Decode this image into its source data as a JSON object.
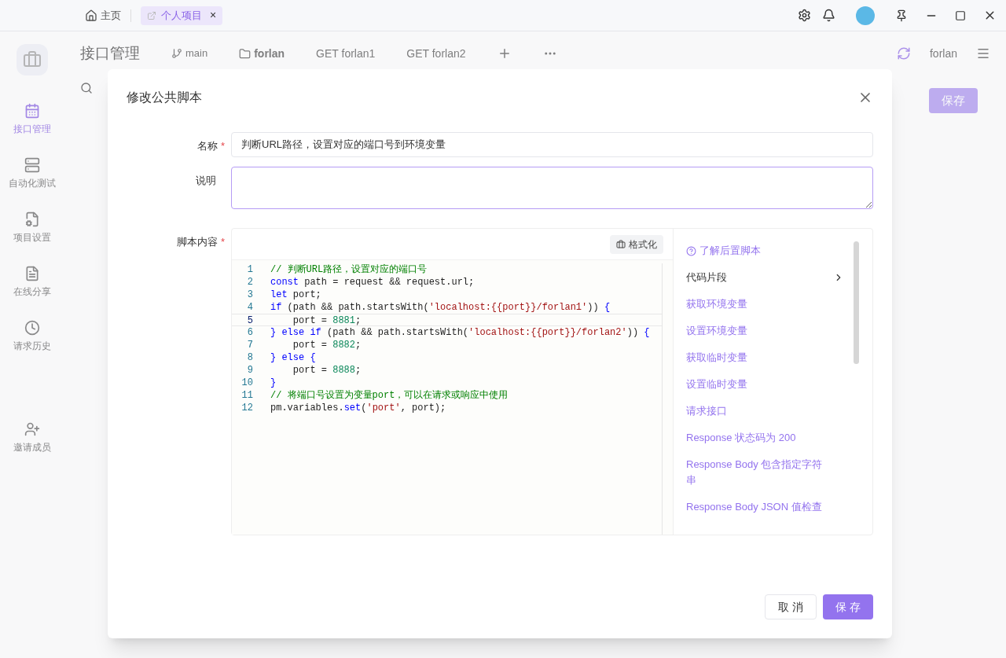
{
  "titlebar": {
    "home": {
      "label": "主页"
    },
    "tabs": [
      {
        "label": "个人项目",
        "selected": true,
        "close": "×"
      }
    ]
  },
  "app": {
    "title": "接口管理",
    "branch": "main",
    "tabs": [
      {
        "kind": "folder",
        "label": "forlan"
      },
      {
        "kind": "request",
        "label": "GET forlan1"
      },
      {
        "kind": "request",
        "label": "GET forlan2"
      }
    ],
    "user": "forlan",
    "save": "保存",
    "nav": [
      {
        "label": "接口管理",
        "selected": true
      },
      {
        "label": "自动化测试",
        "selected": false
      },
      {
        "label": "项目设置",
        "selected": false
      },
      {
        "label": "在线分享",
        "selected": false
      },
      {
        "label": "请求历史",
        "selected": false
      },
      {
        "label": "邀请成员",
        "selected": false
      }
    ]
  },
  "dialog": {
    "title": "修改公共脚本",
    "fields": [
      {
        "label": "名称",
        "required_mark": "*",
        "value": "判断URL路径，设置对应的端口号到环境变量"
      },
      {
        "label": "说明",
        "placeholder_focused": true
      }
    ],
    "script": {
      "label": "脚本内容",
      "required_mark": "*",
      "format_button": "格式化",
      "lines": [
        {
          "number": "1",
          "selected": false,
          "tokens": [
            {
              "kind": "comment",
              "text": "// 判断URL路径，设置对应的端口号"
            }
          ]
        },
        {
          "number": "2",
          "selected": false,
          "tokens": [
            {
              "kind": "keyword",
              "text": "const"
            },
            {
              "kind": "plain",
              "text": " path = request && request.url;"
            }
          ]
        },
        {
          "number": "3",
          "selected": false,
          "tokens": [
            {
              "kind": "keyword",
              "text": "let"
            },
            {
              "kind": "plain",
              "text": " port;"
            }
          ]
        },
        {
          "number": "4",
          "selected": false,
          "tokens": [
            {
              "kind": "keyword",
              "text": "if"
            },
            {
              "kind": "plain",
              "text": " (path && path.startsWith("
            },
            {
              "kind": "string",
              "text": "'localhost:{{port}}/forlan1'"
            },
            {
              "kind": "plain",
              "text": ")) "
            },
            {
              "kind": "keyword",
              "text": "{"
            }
          ]
        },
        {
          "number": "5",
          "selected": true,
          "tokens": [
            {
              "kind": "plain",
              "text": "    port = "
            },
            {
              "kind": "number",
              "text": "8881"
            },
            {
              "kind": "plain",
              "text": ";"
            }
          ]
        },
        {
          "number": "6",
          "selected": false,
          "tokens": [
            {
              "kind": "keyword",
              "text": "} else if"
            },
            {
              "kind": "plain",
              "text": " (path && path.startsWith("
            },
            {
              "kind": "string",
              "text": "'localhost:{{port}}/forlan2'"
            },
            {
              "kind": "plain",
              "text": ")) "
            },
            {
              "kind": "keyword",
              "text": "{"
            }
          ]
        },
        {
          "number": "7",
          "selected": false,
          "tokens": [
            {
              "kind": "plain",
              "text": "    port = "
            },
            {
              "kind": "number",
              "text": "8882"
            },
            {
              "kind": "plain",
              "text": ";"
            }
          ]
        },
        {
          "number": "8",
          "selected": false,
          "tokens": [
            {
              "kind": "keyword",
              "text": "} else {"
            }
          ]
        },
        {
          "number": "9",
          "selected": false,
          "tokens": [
            {
              "kind": "plain",
              "text": "    port = "
            },
            {
              "kind": "number",
              "text": "8888"
            },
            {
              "kind": "plain",
              "text": ";"
            }
          ]
        },
        {
          "number": "10",
          "selected": false,
          "tokens": [
            {
              "kind": "keyword",
              "text": "}"
            }
          ]
        },
        {
          "number": "11",
          "selected": false,
          "tokens": [
            {
              "kind": "comment",
              "text": "// 将端口号设置为变量port，可以在请求或响应中使用"
            }
          ]
        },
        {
          "number": "12",
          "selected": false,
          "tokens": [
            {
              "kind": "plain",
              "text": "pm.variables."
            },
            {
              "kind": "keyword",
              "text": "set"
            },
            {
              "kind": "plain",
              "text": "("
            },
            {
              "kind": "string",
              "text": "'port'"
            },
            {
              "kind": "plain",
              "text": ", port);"
            }
          ]
        }
      ]
    },
    "sidebar": {
      "help_link": "了解后置脚本",
      "heading": "代码片段",
      "snippets": [
        "获取环境变量",
        "设置环境变量",
        "获取临时变量",
        "设置临时变量",
        "请求接口",
        "Response 状态码为 200",
        "Response Body 包含指定字符串",
        "Response Body JSON 值检查"
      ]
    },
    "buttons": [
      {
        "kind": "secondary",
        "label": "取 消"
      },
      {
        "kind": "primary",
        "label": "保 存"
      }
    ]
  }
}
